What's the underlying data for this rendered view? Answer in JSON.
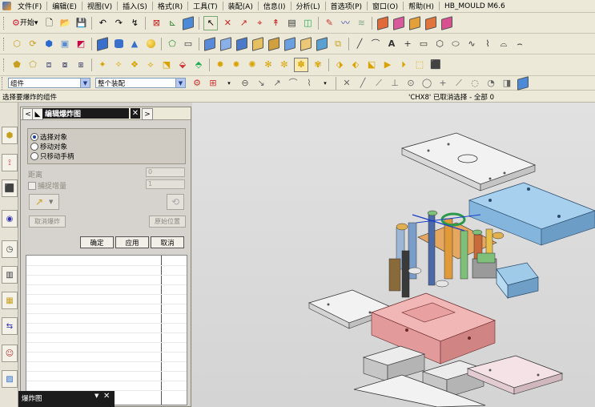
{
  "menubar": {
    "items": [
      "文件(F)",
      "编辑(E)",
      "视图(V)",
      "插入(S)",
      "格式(R)",
      "工具(T)",
      "装配(A)",
      "信息(I)",
      "分析(L)",
      "首选项(P)",
      "窗口(O)",
      "帮助(H)"
    ],
    "app_title": "HB_MOULD M6.6"
  },
  "toolbar1": {
    "start_label": "开始▾"
  },
  "filterbar": {
    "type_filter": "组件",
    "scope_filter": "整个装配"
  },
  "statusbar": {
    "prompt": "选择要爆炸的组件",
    "message": "'CHX8' 已取消选择 - 全部 0"
  },
  "dialog": {
    "title": "编辑爆炸图",
    "radio_options": [
      "选择对象",
      "移动对象",
      "只移动手柄"
    ],
    "selected_radio": 0,
    "distance_label": "距离",
    "distance_value": "0",
    "snap_label": "捕捉增量",
    "snap_value": "1",
    "cancel_explode": "取消爆炸",
    "origin_position": "原始位置",
    "ok": "确定",
    "apply": "应用",
    "cancel": "取消"
  },
  "mini_panel": {
    "title": "爆炸图"
  },
  "colors": {
    "accent_blue": "#7fb3d8",
    "mold_pink": "#e8a0a0",
    "plate_gray": "#f2f2f2"
  }
}
